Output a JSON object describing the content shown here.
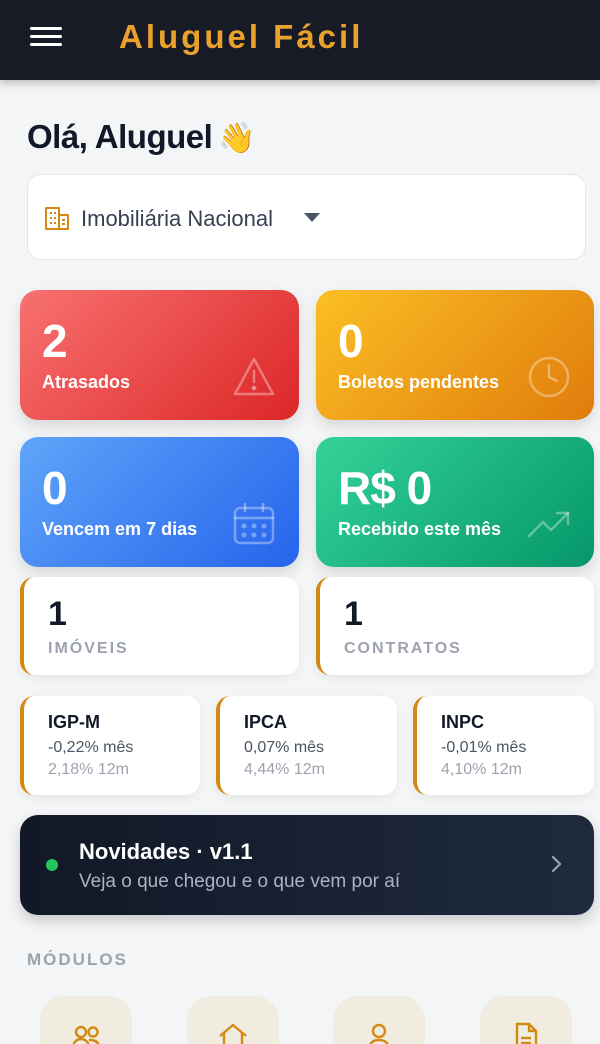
{
  "header": {
    "menu_icon": "hamburger-menu-icon",
    "app_title": "Aluguel Fácil",
    "title_color": "#e9a12c",
    "background": "#161b26"
  },
  "greeting": {
    "text": "Olá, Aluguel",
    "emoji": "👋"
  },
  "agency_selector": {
    "icon": "building-icon",
    "selected": "Imobiliária Nacional"
  },
  "stats": [
    {
      "value": "2",
      "label": "Atrasados",
      "icon": "warning-icon",
      "color": "#ef4444"
    },
    {
      "value": "0",
      "label": "Boletos pendentes",
      "icon": "clock-icon",
      "color": "#f59e0b"
    },
    {
      "value": "0",
      "label": "Vencem em 7 dias",
      "icon": "calendar-icon",
      "color": "#3b82f6"
    },
    {
      "value": "R$ 0",
      "label": "Recebido este mês",
      "icon": "trending-up-icon",
      "color": "#10b981"
    }
  ],
  "counts": [
    {
      "value": "1",
      "label": "IMÓVEIS"
    },
    {
      "value": "1",
      "label": "CONTRATOS"
    }
  ],
  "indices": [
    {
      "name": "IGP-M",
      "month": "-0,22% mês",
      "year": "2,18% 12m"
    },
    {
      "name": "IPCA",
      "month": "0,07% mês",
      "year": "4,44% 12m"
    },
    {
      "name": "INPC",
      "month": "-0,01% mês",
      "year": "4,10% 12m"
    }
  ],
  "news": {
    "title": "Novidades · v1.1",
    "subtitle": "Veja o que chegou e o que vem por aí",
    "status_color": "#22c55e"
  },
  "modules": {
    "heading": "MÓDULOS",
    "items": [
      {
        "icon": "users-icon"
      },
      {
        "icon": "house-icon"
      },
      {
        "icon": "person-icon"
      },
      {
        "icon": "document-icon"
      }
    ]
  },
  "accent_color": "#d38a12"
}
